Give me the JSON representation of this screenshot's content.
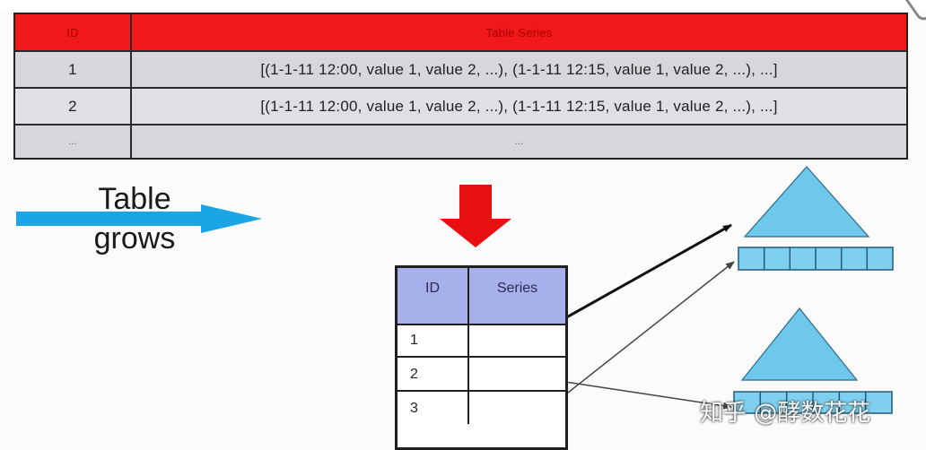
{
  "top_table": {
    "header": {
      "id": "ID",
      "series": "Table Series"
    },
    "rows": [
      {
        "id": "1",
        "series": "[(1-1-11 12:00,  value 1, value 2, ...), (1-1-11 12:15, value 1, value 2, ...), ...]"
      },
      {
        "id": "2",
        "series": "[(1-1-11 12:00,  value 1, value 2, ...), (1-1-11 12:15, value 1, value 2, ...), ...]"
      },
      {
        "id": "...",
        "series": "..."
      }
    ]
  },
  "arrow_label": {
    "line1": "Table",
    "line2": "grows"
  },
  "small_table": {
    "header": {
      "id": "ID",
      "series": "Series"
    },
    "rows": [
      {
        "id": "1"
      },
      {
        "id": "2"
      },
      {
        "id": "3"
      }
    ]
  },
  "colors": {
    "header_red": "#f01818",
    "row_gray": "#d6d7db",
    "arrow_blue": "#1aa6e6",
    "down_arrow_red": "#e81010",
    "small_header_lavender": "#a8b0ec",
    "triangle_blue": "#6ec8ec"
  },
  "icons": {
    "grow_arrow": "right-arrow-icon",
    "down_arrow": "down-arrow-icon"
  },
  "watermark": "知乎 @酵数花花"
}
